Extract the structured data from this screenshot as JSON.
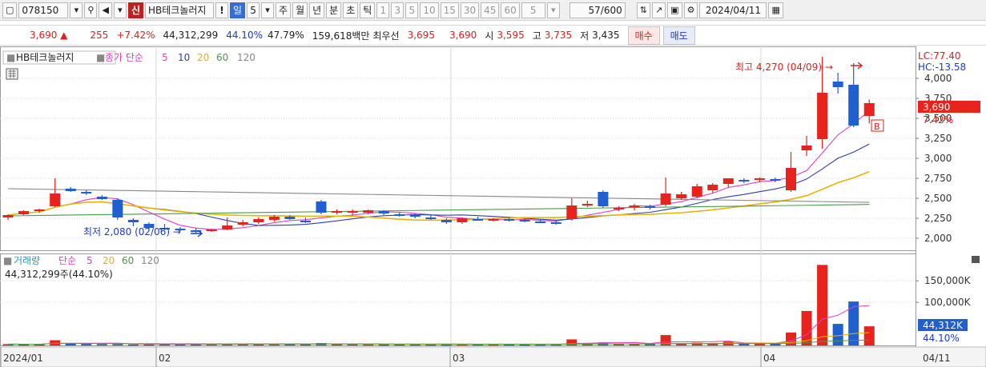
{
  "toolbar": {
    "code": "078150",
    "name": "HB테크놀러지",
    "excl": "!",
    "period_label": "일",
    "period_value": "5",
    "tabs": [
      "주",
      "월",
      "년",
      "분",
      "초",
      "틱"
    ],
    "nums": [
      "1",
      "3",
      "5",
      "10",
      "15",
      "30",
      "45",
      "60"
    ],
    "count_sel": "5",
    "count": "57/600",
    "date": "2024/04/11"
  },
  "quote": {
    "price": "3,690 ▲",
    "change": "255",
    "change_pct": "+7.42%",
    "volume": "44,312,299",
    "vol_pct": "44.10%",
    "ratio": "47.79%",
    "amount": "159,618백만",
    "bid_label": "최우선",
    "bid1": "3,695",
    "bid2": "3,690",
    "open_label": "시",
    "open": "3,595",
    "high_label": "고",
    "high": "3,735",
    "low_label": "저",
    "low": "3,435",
    "buy_label": "매수",
    "sell_label": "매도"
  },
  "colors": {
    "up": "#e8231e",
    "down": "#1f5fd0",
    "ma5": "#e040c0",
    "ma10": "#2f3fb0",
    "ma20": "#e8b400",
    "ma60": "#4a9a4a",
    "ma120": "#888888",
    "panel_grid": "#d9d9d9"
  },
  "price_panel": {
    "legend": {
      "name": "HB테크놀러지",
      "ma_label": "종가 단순",
      "ma": [
        "5",
        "10",
        "20",
        "60",
        "120"
      ]
    },
    "high_text": "최고 4,270 (04/09) →",
    "low_text": "최저 2,080 (02/06) →",
    "lc": "LC:77.40",
    "hc": "HC:-13.58",
    "axis_ticks": [
      "4,000",
      "3,750",
      "3,500",
      "3,250",
      "3,000",
      "2,750",
      "2,500",
      "2,250",
      "2,000"
    ],
    "current": "3,690",
    "current_pct": "7.42%",
    "badge": "B"
  },
  "volume_panel": {
    "legend": {
      "name": "거래량",
      "ma_label": "단순",
      "ma": [
        "5",
        "20",
        "60",
        "120"
      ]
    },
    "info": "44,312,299주(44.10%)",
    "axis_ticks": [
      "150,000K",
      "100,000K"
    ],
    "current": "44,312K",
    "current_pct": "44.10%"
  },
  "x_labels": [
    "2024/01",
    "02",
    "03",
    "04",
    "04/11"
  ],
  "chart_data": {
    "type": "candlestick",
    "x_labels": [
      "2024/01",
      "02",
      "03",
      "04"
    ],
    "ylim": [
      1850,
      4400
    ],
    "vol_ylim": [
      0,
      195000
    ],
    "series": [
      {
        "name": "price",
        "ohlc": [
          [
            2260,
            2300,
            2230,
            2290
          ],
          [
            2300,
            2350,
            2290,
            2340
          ],
          [
            2340,
            2370,
            2320,
            2360
          ],
          [
            2400,
            2750,
            2390,
            2560
          ],
          [
            2620,
            2640,
            2580,
            2590
          ],
          [
            2580,
            2600,
            2540,
            2560
          ],
          [
            2520,
            2540,
            2480,
            2490
          ],
          [
            2480,
            2500,
            2230,
            2260
          ],
          [
            2230,
            2250,
            2150,
            2200
          ],
          [
            2180,
            2200,
            2110,
            2130
          ],
          [
            2130,
            2180,
            2100,
            2120
          ],
          [
            2120,
            2140,
            2090,
            2100
          ],
          [
            2100,
            2130,
            2070,
            2090
          ],
          [
            2090,
            2120,
            2080,
            2110
          ],
          [
            2110,
            2260,
            2100,
            2160
          ],
          [
            2170,
            2230,
            2150,
            2200
          ],
          [
            2200,
            2260,
            2180,
            2240
          ],
          [
            2230,
            2290,
            2210,
            2270
          ],
          [
            2270,
            2290,
            2230,
            2240
          ],
          [
            2220,
            2260,
            2190,
            2210
          ],
          [
            2460,
            2480,
            2300,
            2320
          ],
          [
            2320,
            2360,
            2300,
            2340
          ],
          [
            2320,
            2360,
            2290,
            2340
          ],
          [
            2320,
            2360,
            2300,
            2350
          ],
          [
            2340,
            2350,
            2290,
            2310
          ],
          [
            2300,
            2320,
            2270,
            2290
          ],
          [
            2290,
            2310,
            2250,
            2270
          ],
          [
            2260,
            2290,
            2230,
            2250
          ],
          [
            2230,
            2250,
            2180,
            2200
          ],
          [
            2200,
            2260,
            2180,
            2250
          ],
          [
            2240,
            2270,
            2220,
            2230
          ],
          [
            2230,
            2250,
            2210,
            2240
          ],
          [
            2240,
            2260,
            2210,
            2230
          ],
          [
            2230,
            2250,
            2200,
            2220
          ],
          [
            2210,
            2240,
            2190,
            2200
          ],
          [
            2200,
            2230,
            2170,
            2180
          ],
          [
            2240,
            2500,
            2220,
            2410
          ],
          [
            2420,
            2470,
            2390,
            2430
          ],
          [
            2580,
            2600,
            2380,
            2400
          ],
          [
            2370,
            2400,
            2340,
            2380
          ],
          [
            2390,
            2430,
            2350,
            2410
          ],
          [
            2400,
            2420,
            2360,
            2390
          ],
          [
            2420,
            2760,
            2400,
            2560
          ],
          [
            2500,
            2580,
            2480,
            2550
          ],
          [
            2520,
            2680,
            2500,
            2650
          ],
          [
            2600,
            2690,
            2560,
            2670
          ],
          [
            2680,
            2750,
            2640,
            2750
          ],
          [
            2730,
            2750,
            2690,
            2720
          ],
          [
            2740,
            2760,
            2700,
            2750
          ],
          [
            2740,
            2760,
            2700,
            2720
          ],
          [
            2600,
            3080,
            2580,
            2880
          ],
          [
            3100,
            3280,
            3030,
            3160
          ],
          [
            3240,
            4270,
            3120,
            3820
          ],
          [
            3960,
            4070,
            3810,
            3890
          ],
          [
            3920,
            4190,
            3390,
            3410
          ],
          [
            3530,
            3735,
            3435,
            3690
          ]
        ]
      },
      {
        "name": "volume",
        "values": [
          3000,
          2500,
          2200,
          12000,
          5000,
          3500,
          3200,
          2800,
          2200,
          2600,
          3000,
          2400,
          2500,
          2700,
          3600,
          2800,
          2500,
          3400,
          3000,
          2600,
          5500,
          3000,
          2600,
          2500,
          2200,
          2400,
          2300,
          2100,
          2000,
          2200,
          2400,
          2300,
          2200,
          2100,
          2000,
          2200,
          14000,
          5000,
          7000,
          3500,
          4000,
          3500,
          24000,
          5500,
          6500,
          5000,
          9000,
          4500,
          4500,
          4000,
          30000,
          80000,
          187000,
          50000,
          102000,
          44312
        ]
      },
      {
        "name": "MA5",
        "color": "#e040c0"
      },
      {
        "name": "MA10",
        "color": "#2f3fb0"
      },
      {
        "name": "MA20",
        "color": "#e8b400"
      },
      {
        "name": "MA60",
        "color": "#4a9a4a"
      },
      {
        "name": "MA120",
        "color": "#888888"
      }
    ]
  }
}
